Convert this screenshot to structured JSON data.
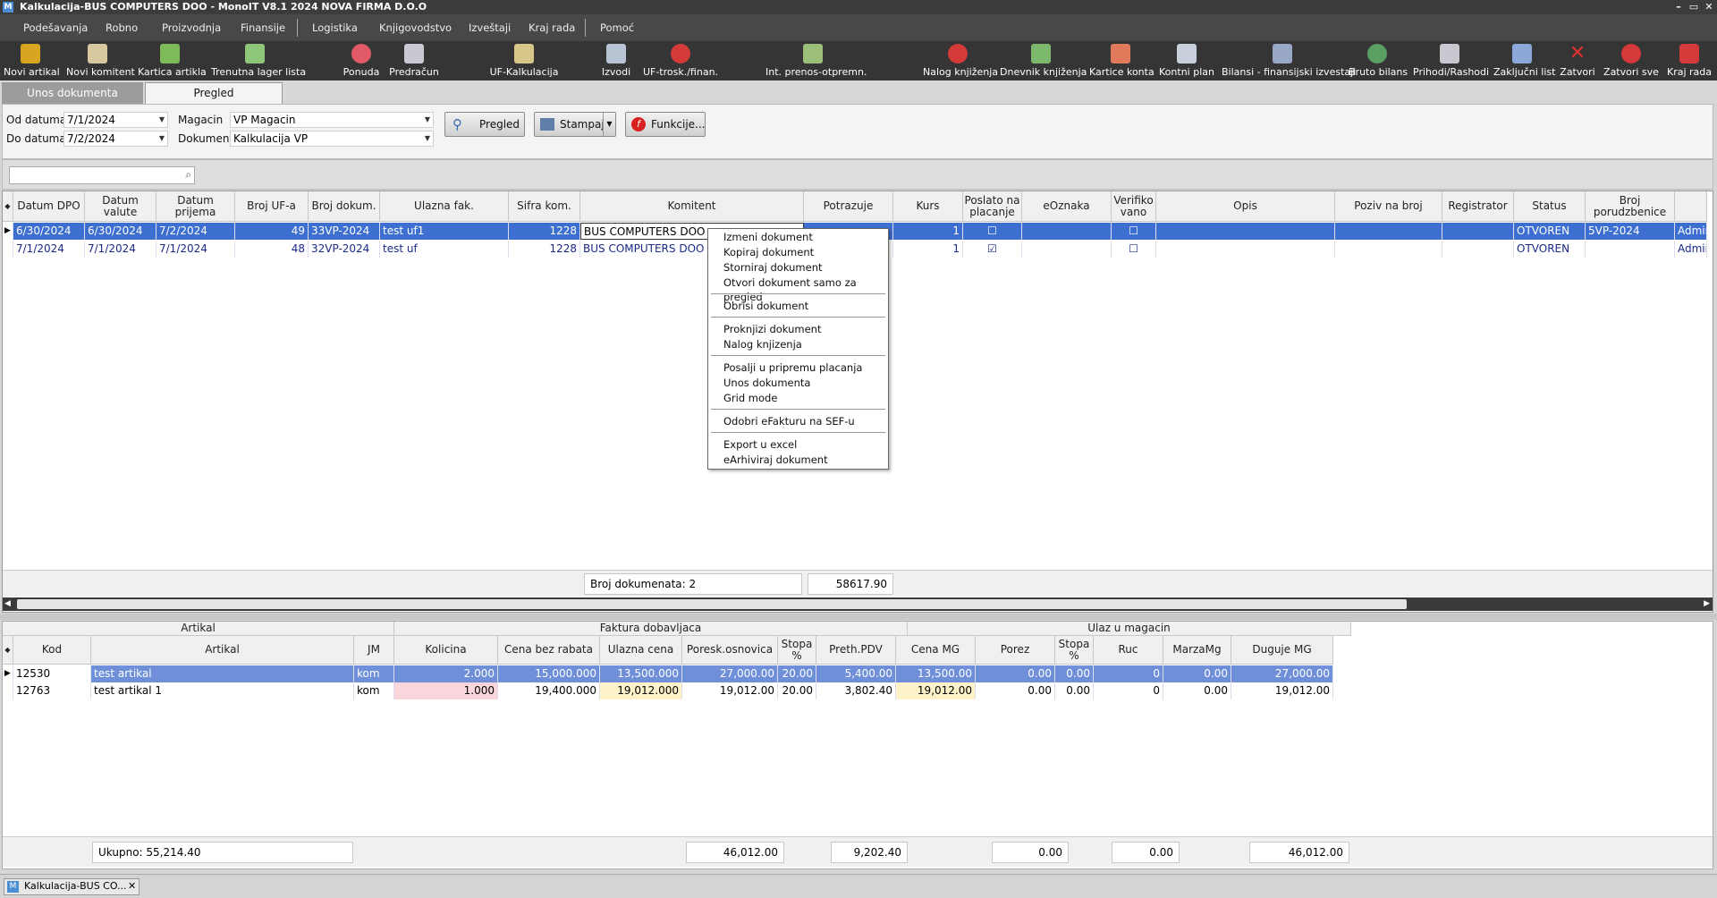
{
  "window": {
    "title": "Kalkulacija-BUS COMPUTERS DOO - MonoIT V8.1 2024 NOVA FIRMA D.O.O",
    "app_icon": "M",
    "minimize": "–",
    "restore": "▭",
    "close": "✕"
  },
  "menu": [
    "Podešavanja",
    "Robno",
    "Proizvodnja",
    "Finansije",
    "Logistika",
    "Knjigovodstvo",
    "Izveštaji",
    "Kraj rada",
    "Pomoć"
  ],
  "toolbar": [
    "Novi artikal",
    "Novi komitent",
    "Kartica artikla",
    "Trenutna lager lista",
    "Ponuda",
    "Predračun",
    "UF-Kalkulacija",
    "Izvodi",
    "UF-trosk./finan.",
    "Int. prenos-otpremn.",
    "Nalog knjiženja",
    "Dnevnik knjiženja",
    "Kartice konta",
    "Kontni plan",
    "Bilansi - finansijski izvestaji",
    "Bruto bilans",
    "Prihodi/Rashodi",
    "Zaključni list",
    "Zatvori",
    "Zatvori sve",
    "Kraj rada"
  ],
  "tabs": {
    "tab1": "Unos dokumenta",
    "tab2": "Pregled"
  },
  "filters": {
    "od_label": "Od datuma",
    "od_value": "7/1/2024",
    "do_label": "Do datuma",
    "do_value": "7/2/2024",
    "magacin_label": "Magacin",
    "magacin_value": "VP Magacin",
    "dokument_label": "Dokument",
    "dokument_value": "Kalkulacija VP",
    "btn_pregled": "Pregled",
    "btn_stampaj": "Stampaj",
    "btn_funkcije": "Funkcije..."
  },
  "search": {
    "value": "",
    "icon": "search-icon"
  },
  "top_grid": {
    "columns": [
      "Datum DPO",
      "Datum valute",
      "Datum prijema",
      "Broj UF-a",
      "Broj dokum.",
      "Ulazna fak.",
      "Sifra kom.",
      "Komitent",
      "Potrazuje",
      "Kurs",
      "Poslato na placanje",
      "eOznaka",
      "Verifiko vano",
      "Opis",
      "Poziv na broj",
      "Registrator",
      "Status",
      "Broj porudzbenice",
      ""
    ],
    "rows": [
      {
        "c": [
          "6/30/2024",
          "6/30/2024",
          "7/2/2024",
          "49",
          "33VP-2024",
          "test uf1",
          "1228",
          "BUS COMPUTERS DOO",
          "",
          "1",
          "☐",
          "",
          "☐",
          "",
          "",
          "",
          "OTVOREN",
          "5VP-2024",
          "Admin"
        ]
      },
      {
        "c": [
          "7/1/2024",
          "7/1/2024",
          "7/1/2024",
          "48",
          "32VP-2024",
          "test uf",
          "1228",
          "BUS COMPUTERS DOO",
          "",
          "1",
          "☑",
          "",
          "☐",
          "",
          "",
          "",
          "OTVOREN",
          "",
          "Admin"
        ]
      }
    ],
    "footer_count": "Broj dokumenata: 2",
    "footer_total": "58617.90"
  },
  "context_menu": {
    "items": [
      "Izmeni dokument",
      "Kopiraj dokument",
      "Storniraj dokument",
      "Otvori dokument samo za pregled",
      "Obrisi dokument",
      "Proknjizi dokument",
      "Nalog knjizenja",
      "Posalji u pripremu placanja",
      "Unos dokumenta",
      "Grid mode",
      "Odobri eFakturu na SEF-u",
      "Export u excel",
      "eArhiviraj dokument"
    ]
  },
  "bottom_grid": {
    "groups": {
      "artikal": "Artikal",
      "faktura": "Faktura dobavljaca",
      "ulaz": "Ulaz u magacin"
    },
    "columns": [
      "Kod",
      "Artikal",
      "JM",
      "Kolicina",
      "Cena bez rabata",
      "Ulazna cena",
      "Poresk.osnovica",
      "Stopa %",
      "Preth.PDV",
      "Cena MG",
      "Porez",
      "Stopa %",
      "Ruc",
      "MarzaMg",
      "Duguje MG"
    ],
    "rows": [
      {
        "c": [
          "12530",
          "test artikal",
          "kom",
          "2.000",
          "15,000.000",
          "13,500.000",
          "27,000.00",
          "20.00",
          "5,400.00",
          "13,500.00",
          "0.00",
          "0.00",
          "0",
          "0.00",
          "27,000.00"
        ]
      },
      {
        "c": [
          "12763",
          "test artikal 1",
          "kom",
          "1.000",
          "19,400.000",
          "19,012.000",
          "19,012.00",
          "20.00",
          "3,802.40",
          "19,012.00",
          "0.00",
          "0.00",
          "0",
          "0.00",
          "19,012.00"
        ]
      }
    ],
    "footer": {
      "ukupno": "Ukupno:  55,214.40",
      "poresk": "46,012.00",
      "pdv": "9,202.40",
      "porez": "0.00",
      "marza": "0.00",
      "duguje": "46,012.00"
    }
  },
  "taskbar": {
    "item": "Kalkulacija-BUS CO...",
    "close": "✕"
  }
}
